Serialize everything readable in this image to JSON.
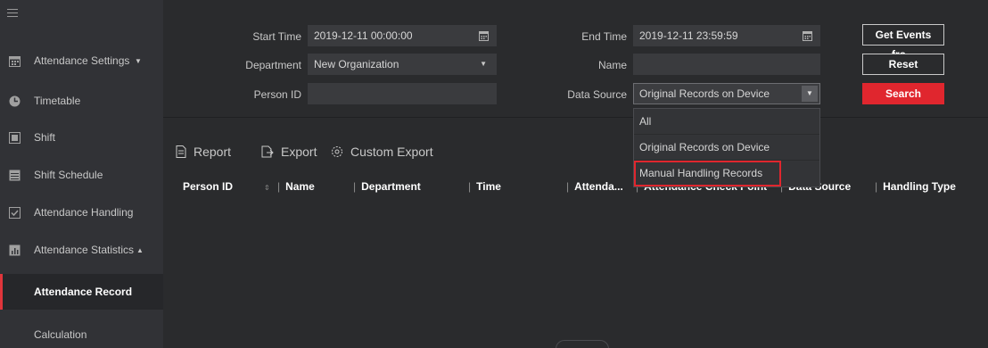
{
  "sidebar": {
    "items": [
      {
        "label": "Attendance Settings",
        "caret": "▼"
      },
      {
        "label": "Timetable"
      },
      {
        "label": "Shift"
      },
      {
        "label": "Shift Schedule"
      },
      {
        "label": "Attendance Handling"
      },
      {
        "label": "Attendance Statistics",
        "caret": "▲"
      },
      {
        "label": "Attendance Record"
      },
      {
        "label": "Calculation"
      }
    ]
  },
  "filters": {
    "start_time_label": "Start Time",
    "start_time_value": "2019-12-11 00:00:00",
    "end_time_label": "End Time",
    "end_time_value": "2019-12-11 23:59:59",
    "department_label": "Department",
    "department_value": "New Organization",
    "name_label": "Name",
    "name_value": "",
    "person_id_label": "Person ID",
    "person_id_value": "",
    "data_source_label": "Data Source",
    "data_source_value": "Original Records on Device",
    "data_source_options": [
      "All",
      "Original Records on Device",
      "Manual Handling Records"
    ]
  },
  "buttons": {
    "get_events": "Get Events fro...",
    "reset": "Reset",
    "search": "Search"
  },
  "toolbar": {
    "report": "Report",
    "export": "Export",
    "custom_export": "Custom Export"
  },
  "table": {
    "columns": [
      "Person ID",
      "Name",
      "Department",
      "Time",
      "Attenda...",
      "Attendance Check Point",
      "Data Source",
      "Handling Type"
    ]
  },
  "colors": {
    "accent": "#e0262e",
    "background": "#2a2b2d",
    "sidebar": "#313236"
  }
}
